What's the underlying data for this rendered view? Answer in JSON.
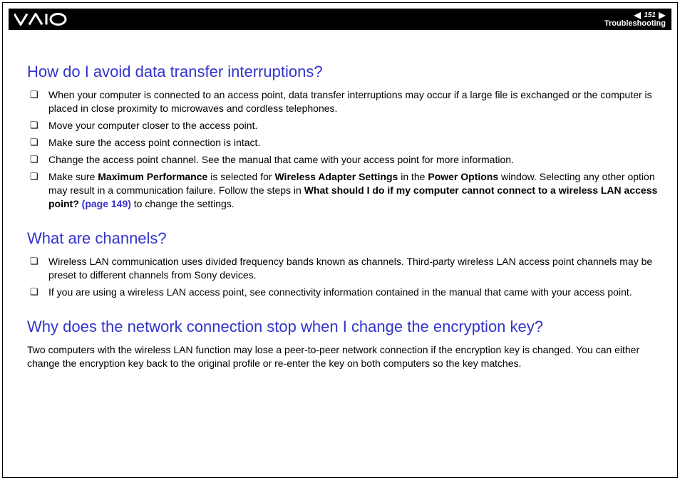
{
  "header": {
    "page_number": "151",
    "section": "Troubleshooting"
  },
  "sections": [
    {
      "title": "How do I avoid data transfer interruptions?",
      "type": "list",
      "items": [
        {
          "runs": [
            {
              "t": "When your computer is connected to an access point, data transfer interruptions may occur if a large file is exchanged or the computer is placed in close proximity to microwaves and cordless telephones."
            }
          ]
        },
        {
          "runs": [
            {
              "t": "Move your computer closer to the access point."
            }
          ]
        },
        {
          "runs": [
            {
              "t": "Make sure the access point connection is intact."
            }
          ]
        },
        {
          "runs": [
            {
              "t": "Change the access point channel. See the manual that came with your access point for more information."
            }
          ]
        },
        {
          "runs": [
            {
              "t": "Make sure "
            },
            {
              "t": "Maximum Performance",
              "b": true
            },
            {
              "t": " is selected for "
            },
            {
              "t": "Wireless Adapter Settings",
              "b": true
            },
            {
              "t": " in the "
            },
            {
              "t": "Power Options",
              "b": true
            },
            {
              "t": " window. Selecting any other option may result in a communication failure. Follow the steps in "
            },
            {
              "t": "What should I do if my computer cannot connect to a wireless LAN access point? ",
              "b": true
            },
            {
              "t": "(page 149)",
              "link": true
            },
            {
              "t": " to change the settings."
            }
          ]
        }
      ]
    },
    {
      "title": "What are channels?",
      "type": "list",
      "items": [
        {
          "runs": [
            {
              "t": "Wireless LAN communication uses divided frequency bands known as channels. Third-party wireless LAN access point channels may be preset to different channels from Sony devices."
            }
          ]
        },
        {
          "runs": [
            {
              "t": "If you are using a wireless LAN access point, see connectivity information contained in the manual that came with your access point."
            }
          ]
        }
      ]
    },
    {
      "title": "Why does the network connection stop when I change the encryption key?",
      "type": "paragraph",
      "text": "Two computers with the wireless LAN function may lose a peer-to-peer network connection if the encryption key is changed. You can either change the encryption key back to the original profile or re-enter the key on both computers so the key matches."
    }
  ]
}
